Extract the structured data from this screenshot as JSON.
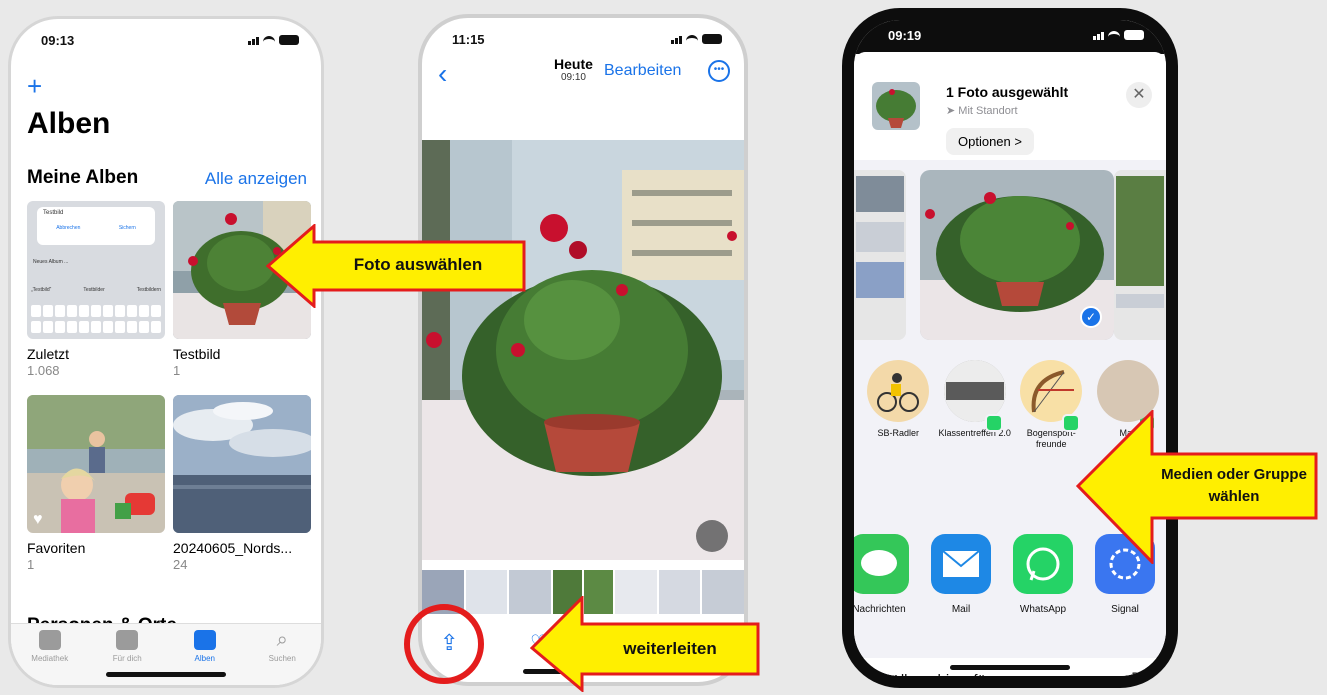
{
  "phones": [
    {
      "time": "09:13",
      "add_icon": "plus-icon",
      "title": "Alben",
      "section": "Meine Alben",
      "show_all": "Alle anzeigen",
      "albums": [
        {
          "name": "Zuletzt",
          "count": "1.068"
        },
        {
          "name": "Testbild",
          "count": "1"
        },
        {
          "name": "Favoriten",
          "count": "1"
        },
        {
          "name": "20240605_Nords...",
          "count": "24"
        }
      ],
      "keyboard_preview": {
        "dialog_text": "Testbild",
        "cancel": "Abbrechen",
        "confirm": "Sichern",
        "new_album": "Neues Album ...",
        "suggestions": [
          "„Testbild“",
          "Testbilder",
          "Testbildern"
        ]
      },
      "tabs": [
        {
          "label": "Mediathek",
          "icon": "photos-icon"
        },
        {
          "label": "Für dich",
          "icon": "for-you-icon"
        },
        {
          "label": "Alben",
          "icon": "albums-icon"
        },
        {
          "label": "Suchen",
          "icon": "search-icon"
        }
      ],
      "next_section_peek": "Personen & Orte"
    },
    {
      "time": "11:15",
      "date": "Heute",
      "clock": "09:10",
      "edit": "Bearbeiten",
      "back_icon": "chevron-left-icon",
      "more_icon": "more-icon",
      "share_icon": "share-icon",
      "heart_icon": "heart-icon"
    },
    {
      "time": "09:19",
      "sheet_title": "1 Foto ausgewählt",
      "sheet_subtitle": "Mit Standort",
      "options": "Optionen >",
      "close_icon": "close-icon",
      "contacts": [
        {
          "label": "SB-Radler"
        },
        {
          "label": "Klassentreffen 2.0"
        },
        {
          "label": "Bogensport-freunde"
        },
        {
          "label": "Mall"
        }
      ],
      "apps": [
        {
          "label": "Nachrichten",
          "color": "#34c759",
          "icon": "messages-icon"
        },
        {
          "label": "Mail",
          "color": "#1e88e5",
          "icon": "mail-icon"
        },
        {
          "label": "WhatsApp",
          "color": "#25d366",
          "icon": "whatsapp-icon"
        },
        {
          "label": "Signal",
          "color": "#3a76f0",
          "icon": "signal-icon"
        }
      ],
      "add_to_album": "Zu Album hinzufügen",
      "add_album_icon": "stack-add-icon"
    }
  ],
  "callouts": {
    "select_photo": "Foto auswählen",
    "forward": "weiterleiten",
    "choose_media": "Medien  oder Gruppe wählen"
  },
  "colors": {
    "ios_blue": "#1a73e8",
    "callout_fill": "#ffef00",
    "callout_border": "#e41c1c",
    "background": "#e9e9e9"
  }
}
